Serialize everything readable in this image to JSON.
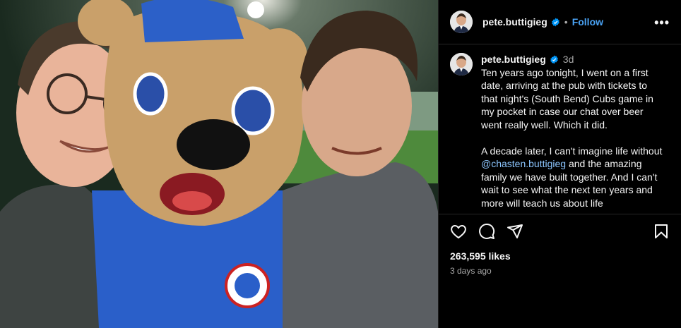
{
  "post": {
    "username": "pete.buttigieg",
    "follow_label": "Follow",
    "dot": "•",
    "more_label": "•••",
    "time_ago_short": "3d",
    "caption_before_mention": "Ten years ago tonight, I went on a first date, arriving at the pub with tickets to that night's (South Bend) Cubs game in my pocket in case our chat over beer went really well. Which it did.\n\nA decade later, I can't imagine life without ",
    "mention": "@chasten.buttigieg",
    "caption_after_mention": " and the amazing family we have built together. And I can't wait to see what the next ten years and more will teach us about life",
    "likes": "263,595 likes",
    "posted": "3 days ago"
  },
  "icons": [
    "heart-icon",
    "comment-icon",
    "share-icon",
    "bookmark-icon",
    "verified-badge-icon",
    "more-options-icon"
  ],
  "colors": {
    "accent": "#4aa3f5",
    "background": "#000000",
    "muted": "#a8a8a8"
  }
}
